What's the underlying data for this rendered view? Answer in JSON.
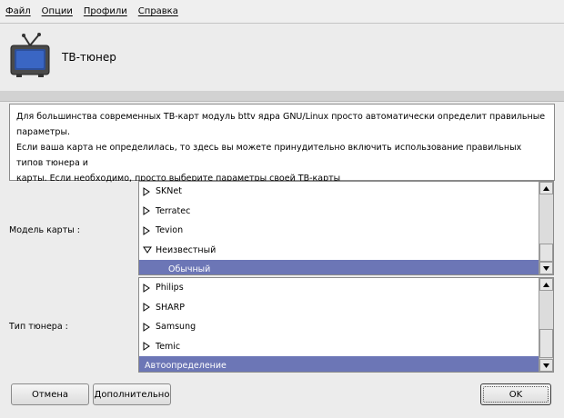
{
  "menu": [
    "Файл",
    "Опции",
    "Профили",
    "Справка"
  ],
  "header": {
    "title": "ТВ-тюнер"
  },
  "description": {
    "lines": [
      "Для большинства современных ТВ-карт модуль bttv ядра GNU/Linux просто автоматически определит правильные параметры.",
      "Если ваша карта не определилась, то здесь вы можете принудительно включить использование правильных типов тюнера и",
      "карты. Если необходимо, просто выберите параметры своей ТВ-карты"
    ]
  },
  "card_model": {
    "label": "Модель карты :",
    "items": [
      "SKNet",
      "Terratec",
      "Tevion",
      "Неизвестный"
    ],
    "selected": "Обычный"
  },
  "tuner_type": {
    "label": "Тип тюнера :",
    "items": [
      "Philips",
      "SHARP",
      "Samsung",
      "Temic"
    ],
    "selected": "Автоопределение"
  },
  "buttons": {
    "cancel": "Отмена",
    "advanced": "Дополнительно",
    "ok": "OK"
  },
  "colors": {
    "selection": "#6c76b6",
    "background": "#ececec"
  }
}
